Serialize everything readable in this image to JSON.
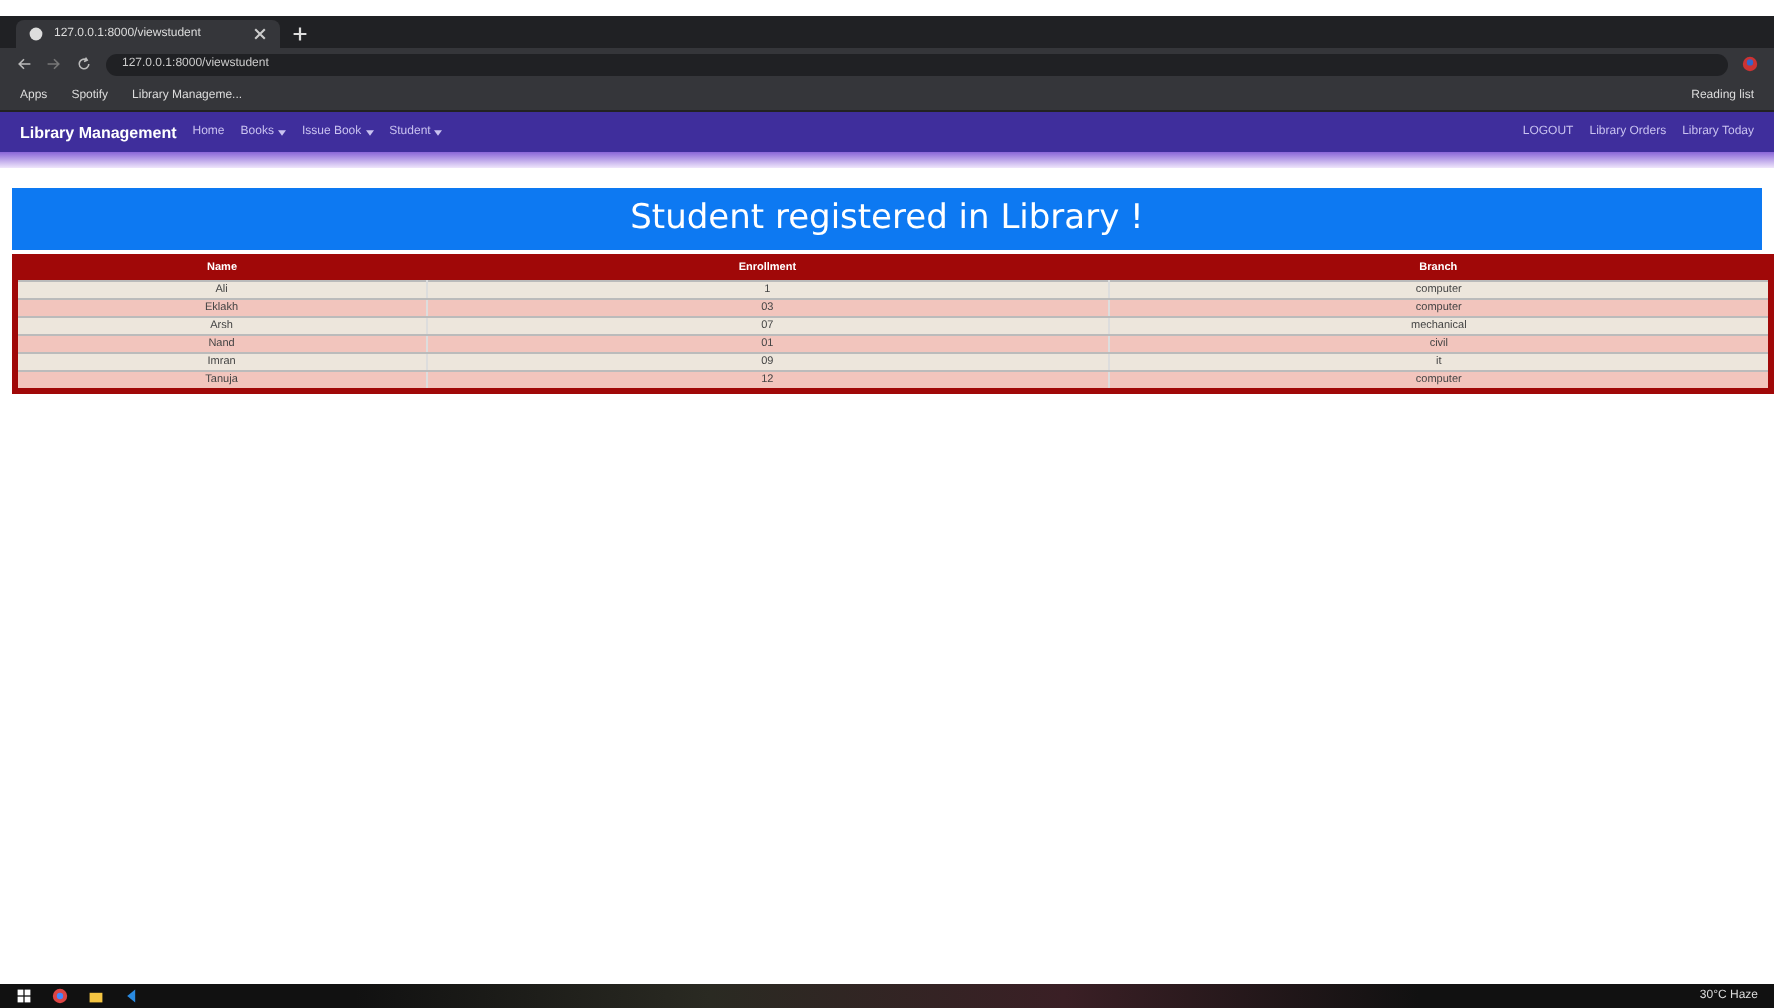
{
  "browser": {
    "tab_title": "127.0.0.1:8000/viewstudent",
    "address": "127.0.0.1:8000/viewstudent",
    "bookmarks": [
      "Apps",
      "Spotify",
      "Library Manageme..."
    ],
    "reading_list": "Reading list"
  },
  "navbar": {
    "brand": "Library Management",
    "links": [
      {
        "label": "Home",
        "dropdown": false
      },
      {
        "label": "Books",
        "dropdown": true
      },
      {
        "label": "Issue Book",
        "dropdown": true
      },
      {
        "label": "Student",
        "dropdown": true
      }
    ],
    "right_links": [
      "LOGOUT",
      "Library Orders",
      "Library Today"
    ]
  },
  "heading": "Student registered in Library !",
  "table": {
    "columns": [
      "Name",
      "Enrollment",
      "Branch"
    ],
    "rows": [
      [
        "Ali",
        "1",
        "computer"
      ],
      [
        "Eklakh",
        "03",
        "computer"
      ],
      [
        "Arsh",
        "07",
        "mechanical"
      ],
      [
        "Nand",
        "01",
        "civil"
      ],
      [
        "Imran",
        "09",
        "it"
      ],
      [
        "Tanuja",
        "12",
        "computer"
      ]
    ]
  },
  "taskbar": {
    "weather": "30°C Haze"
  }
}
